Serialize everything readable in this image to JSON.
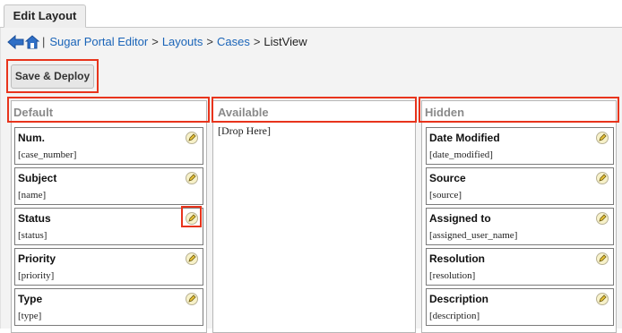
{
  "tab": {
    "label": "Edit Layout"
  },
  "breadcrumb": {
    "items": [
      "Sugar Portal Editor",
      "Layouts",
      "Cases"
    ],
    "current": "ListView",
    "separator": ">",
    "pipe": "|"
  },
  "toolbar": {
    "save_deploy_label": "Save & Deploy"
  },
  "columns": {
    "default": {
      "title": "Default",
      "fields": [
        {
          "label": "Num.",
          "name": "[case_number]"
        },
        {
          "label": "Subject",
          "name": "[name]"
        },
        {
          "label": "Status",
          "name": "[status]"
        },
        {
          "label": "Priority",
          "name": "[priority]"
        },
        {
          "label": "Type",
          "name": "[type]"
        }
      ]
    },
    "available": {
      "title": "Available",
      "drop_text": "[Drop Here]"
    },
    "hidden": {
      "title": "Hidden",
      "fields": [
        {
          "label": "Date Modified",
          "name": "[date_modified]"
        },
        {
          "label": "Source",
          "name": "[source]"
        },
        {
          "label": "Assigned to",
          "name": "[assigned_user_name]"
        },
        {
          "label": "Resolution",
          "name": "[resolution]"
        },
        {
          "label": "Description",
          "name": "[description]"
        }
      ]
    }
  },
  "colors": {
    "highlight": "#e8341c",
    "link": "#1a64b8",
    "header_text": "#8a8a8a"
  },
  "icons": {
    "back": "back-arrow-icon",
    "home": "home-icon",
    "edit": "pencil-icon"
  }
}
